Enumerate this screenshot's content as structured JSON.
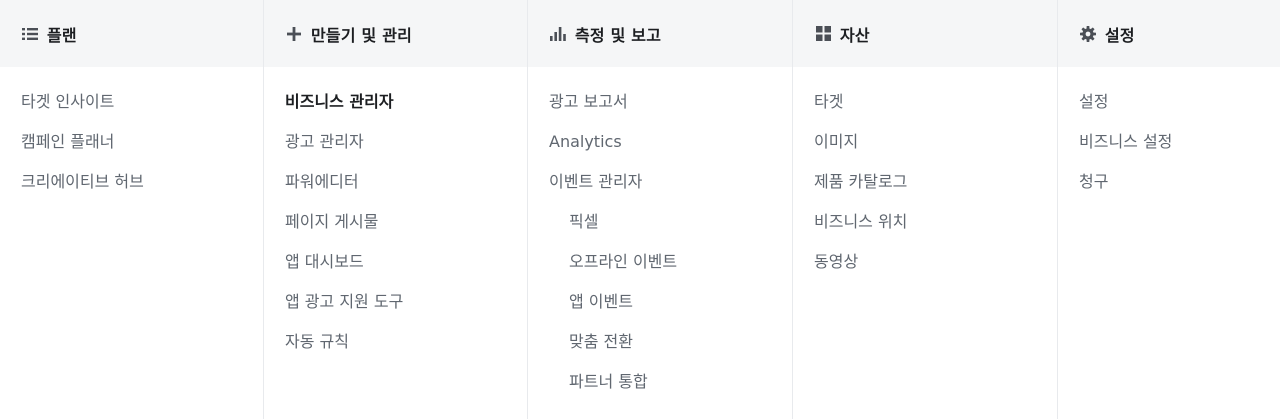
{
  "columns": [
    {
      "title": "플랜",
      "icon": "list-icon",
      "items": [
        {
          "label": "타겟 인사이트"
        },
        {
          "label": "캠페인 플래너"
        },
        {
          "label": "크리에이티브 허브"
        }
      ]
    },
    {
      "title": "만들기 및 관리",
      "icon": "plus-icon",
      "items": [
        {
          "label": "비즈니스 관리자",
          "active": true
        },
        {
          "label": "광고 관리자"
        },
        {
          "label": "파워에디터"
        },
        {
          "label": "페이지 게시물"
        },
        {
          "label": "앱 대시보드"
        },
        {
          "label": "앱 광고 지원 도구"
        },
        {
          "label": "자동 규칙"
        }
      ]
    },
    {
      "title": "측정 및 보고",
      "icon": "bar-chart-icon",
      "items": [
        {
          "label": "광고 보고서"
        },
        {
          "label": "Analytics"
        },
        {
          "label": "이벤트 관리자"
        },
        {
          "label": "픽셀",
          "sub": true
        },
        {
          "label": "오프라인 이벤트",
          "sub": true
        },
        {
          "label": "앱 이벤트",
          "sub": true
        },
        {
          "label": "맞춤 전환",
          "sub": true
        },
        {
          "label": "파트너 통합",
          "sub": true
        }
      ]
    },
    {
      "title": "자산",
      "icon": "grid-icon",
      "items": [
        {
          "label": "타겟"
        },
        {
          "label": "이미지"
        },
        {
          "label": "제품 카탈로그"
        },
        {
          "label": "비즈니스 위치"
        },
        {
          "label": "동영상"
        }
      ]
    },
    {
      "title": "설정",
      "icon": "gear-icon",
      "items": [
        {
          "label": "설정"
        },
        {
          "label": "비즈니스 설정"
        },
        {
          "label": "청구"
        }
      ]
    }
  ]
}
